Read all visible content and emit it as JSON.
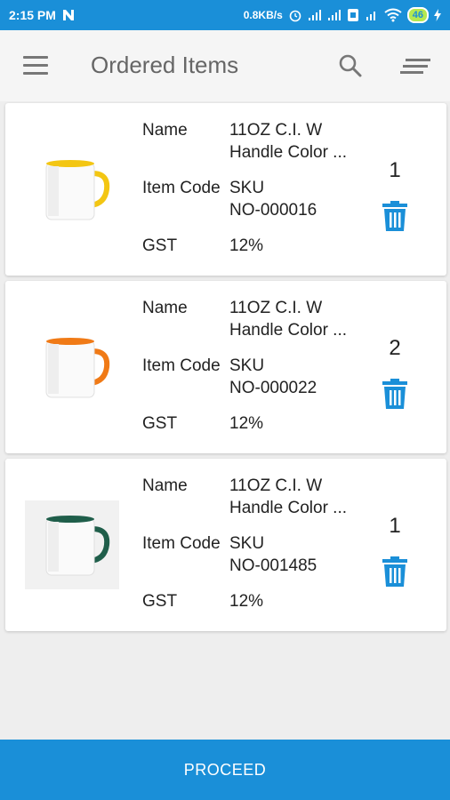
{
  "status_bar": {
    "time": "2:15 PM",
    "network_speed": "0.8KB/s",
    "battery": "46",
    "icons": [
      "notification-n-icon",
      "alarm-icon",
      "signal-icon",
      "signal-icon",
      "sim-icon",
      "4g-icon",
      "wifi-icon",
      "battery-icon",
      "charging-icon"
    ]
  },
  "app_bar": {
    "title": "Ordered Items",
    "icons": [
      "menu-icon",
      "search-icon",
      "sort-icon"
    ]
  },
  "labels": {
    "name": "Name",
    "item_code": "Item Code",
    "gst": "GST"
  },
  "items": [
    {
      "name_line1": "11OZ C.I. W",
      "name_line2": "Handle Color ...",
      "code_line1": "SKU",
      "code_line2": "NO-000016",
      "gst": "12%",
      "quantity": "1",
      "mug_color": "#f3c613"
    },
    {
      "name_line1": "11OZ C.I. W",
      "name_line2": "Handle Color ...",
      "code_line1": "SKU",
      "code_line2": "NO-000022",
      "gst": "12%",
      "quantity": "2",
      "mug_color": "#f07a16"
    },
    {
      "name_line1": "11OZ C.I. W",
      "name_line2": "Handle Color ...",
      "code_line1": "SKU",
      "code_line2": "NO-001485",
      "gst": "12%",
      "quantity": "1",
      "mug_color": "#1f5e4a"
    }
  ],
  "proceed_label": "PROCEED",
  "colors": {
    "primary": "#1a8fd8",
    "trash": "#1a8fd8"
  }
}
